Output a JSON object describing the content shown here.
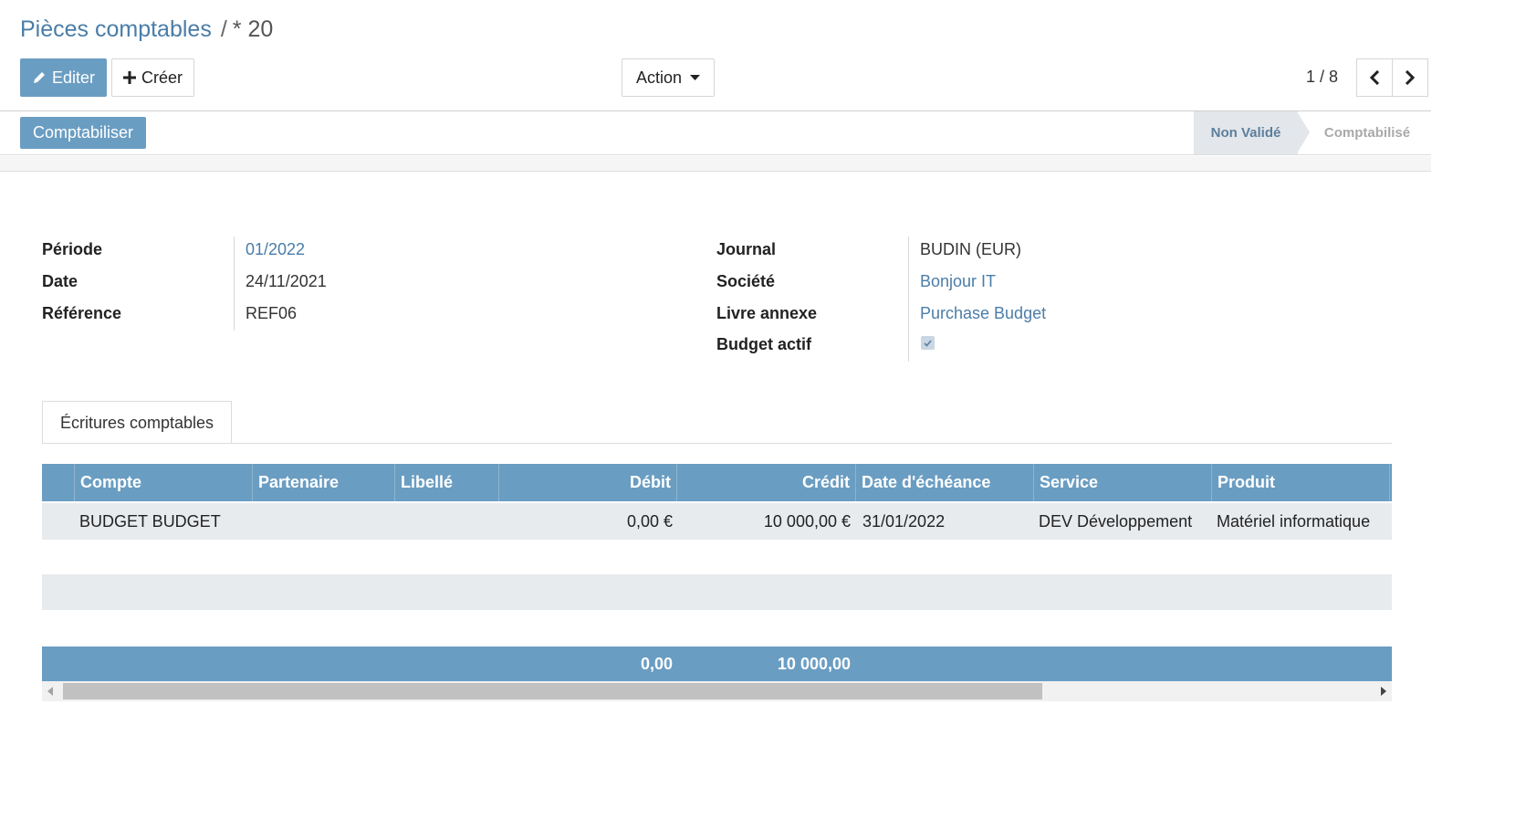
{
  "breadcrumb": {
    "parent": "Pièces comptables",
    "separator": "/",
    "current": "* 20"
  },
  "toolbar": {
    "edit_label": "Editer",
    "create_label": "Créer",
    "action_label": "Action",
    "pager": "1 / 8"
  },
  "statusbar": {
    "post_label": "Comptabiliser",
    "stages": [
      "Non Validé",
      "Comptabilisé"
    ]
  },
  "form": {
    "left": [
      {
        "label": "Période",
        "value": "01/2022"
      },
      {
        "label": "Date",
        "value": "24/11/2021"
      },
      {
        "label": "Référence",
        "value": "REF06"
      }
    ],
    "right": [
      {
        "label": "Journal",
        "value": "BUDIN (EUR)"
      },
      {
        "label": "Société",
        "value": "Bonjour IT"
      },
      {
        "label": "Livre annexe",
        "value": "Purchase Budget"
      },
      {
        "label": "Budget actif",
        "value": true
      }
    ]
  },
  "tabs": [
    {
      "label": "Écritures comptables"
    }
  ],
  "table": {
    "columns": [
      "Compte",
      "Partenaire",
      "Libellé",
      "Débit",
      "Crédit",
      "Date d'échéance",
      "Service",
      "Produit"
    ],
    "rows": [
      [
        "BUDGET BUDGET",
        "",
        "",
        "0,00 €",
        "10 000,00 €",
        "31/01/2022",
        "DEV Développement",
        "Matériel informatique"
      ]
    ],
    "totals": {
      "debit": "0,00",
      "credit": "10 000,00"
    }
  },
  "colors": {
    "accent": "#6a9dc2",
    "link": "#4a7da8",
    "row_bg": "#e8ebee"
  }
}
